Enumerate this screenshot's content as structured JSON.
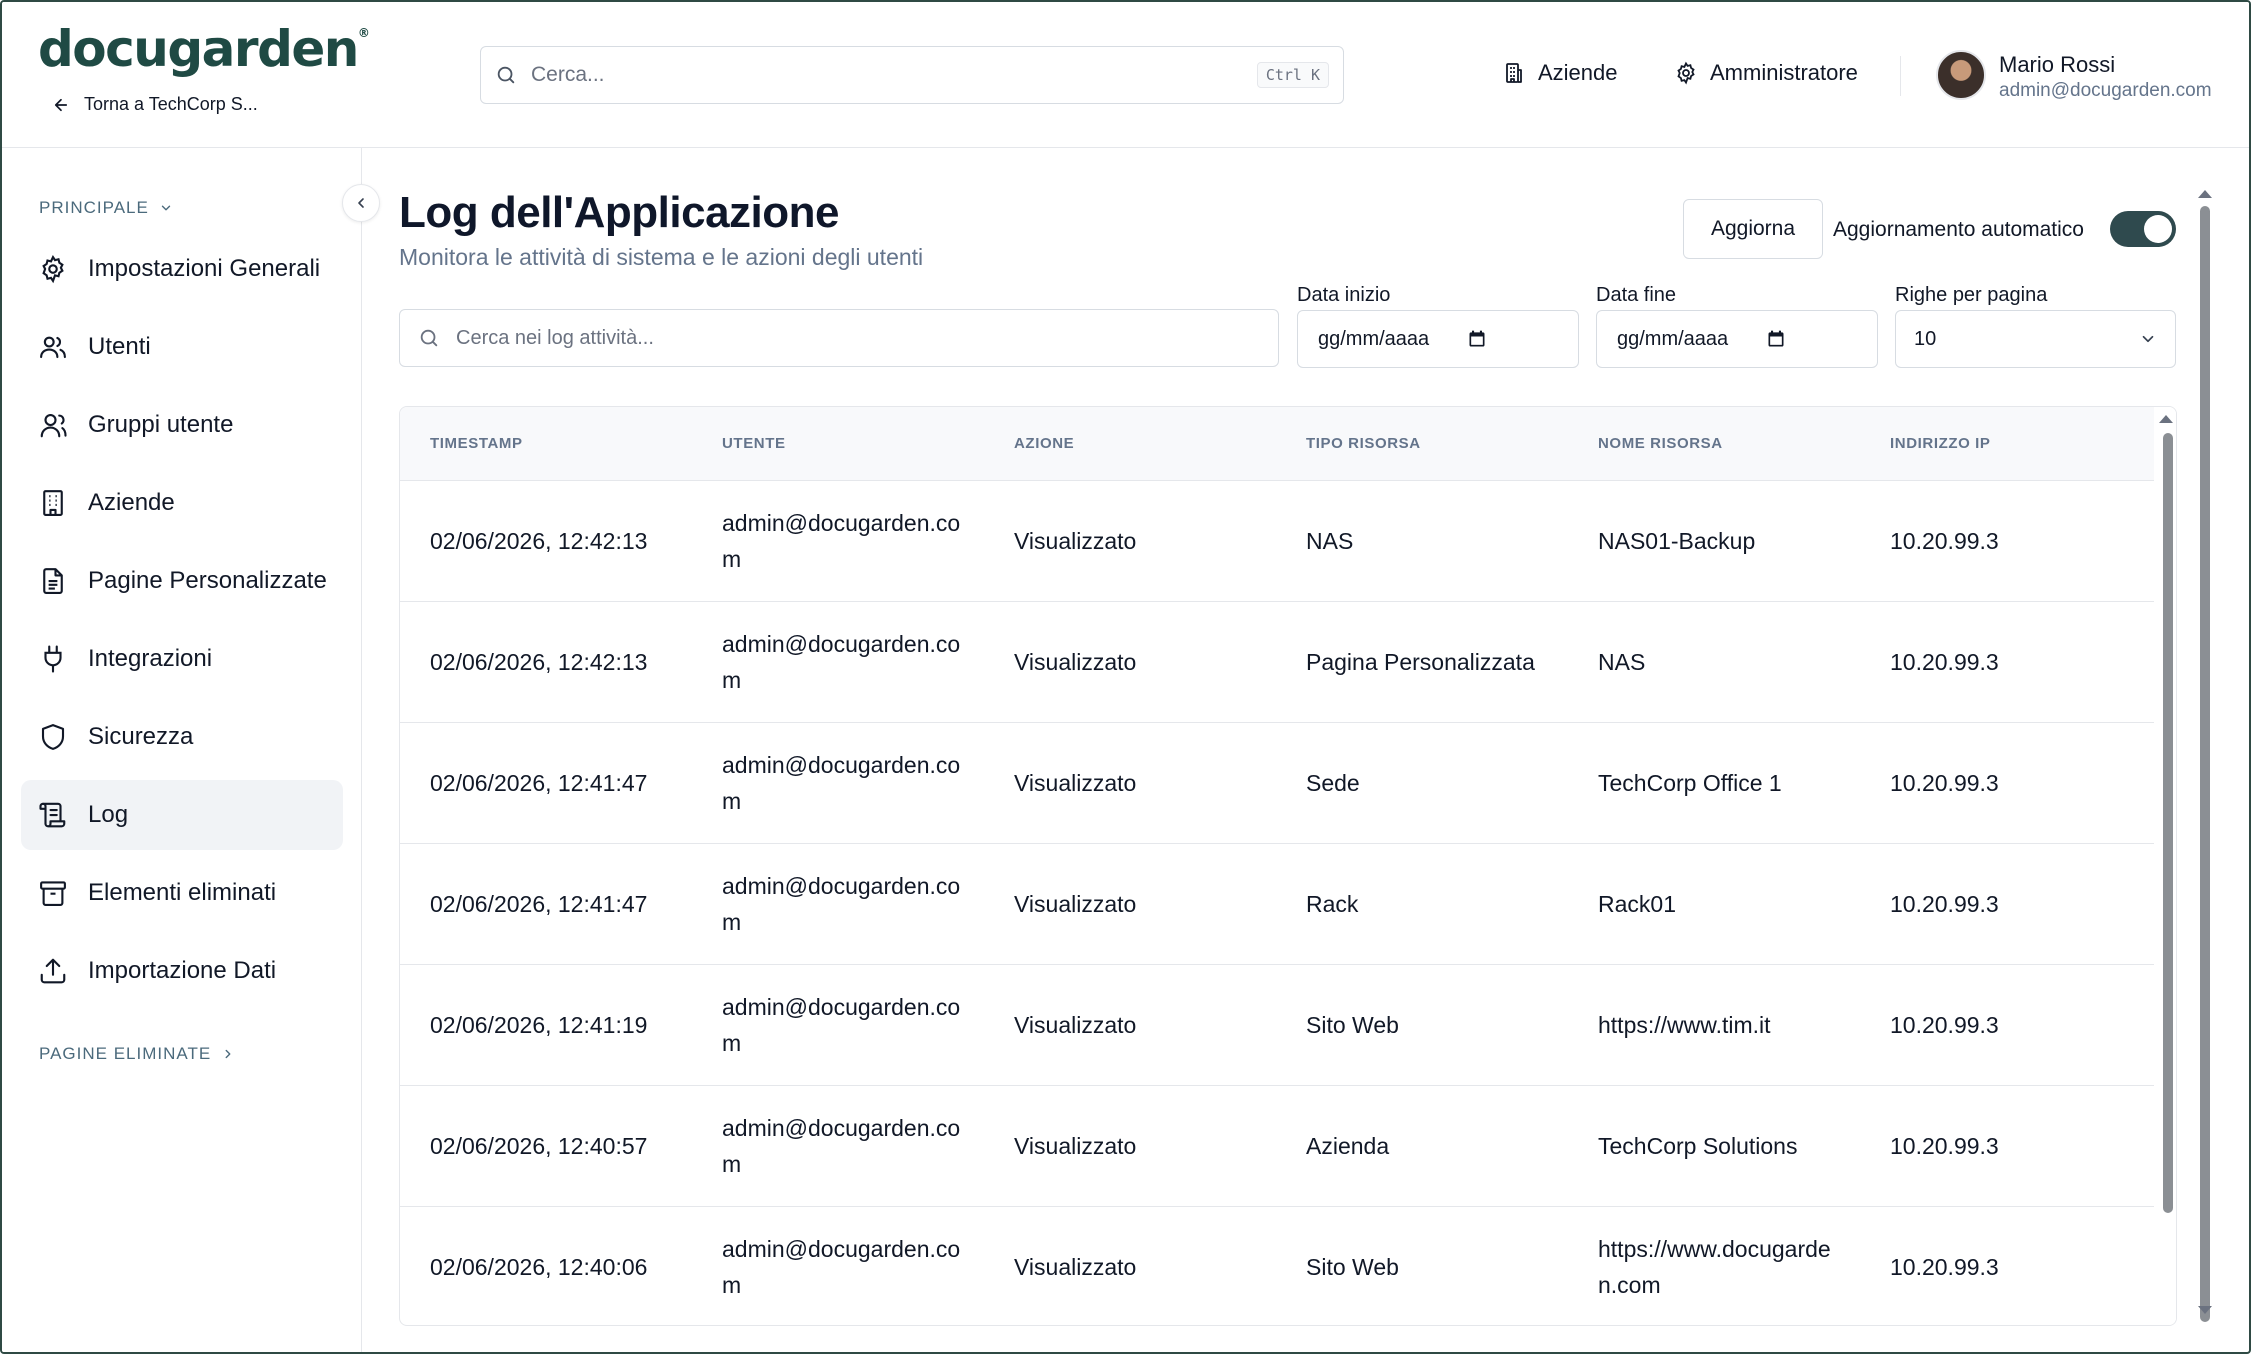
{
  "header": {
    "logo_text": "docugarden",
    "logo_mark": "®",
    "back_link": "Torna a TechCorp S...",
    "search_placeholder": "Cerca...",
    "search_shortcut": "Ctrl K",
    "nav": [
      {
        "label": "Aziende",
        "icon": "building-icon"
      },
      {
        "label": "Amministratore",
        "icon": "gear-icon"
      }
    ],
    "user": {
      "name": "Mario Rossi",
      "email": "admin@docugarden.com"
    }
  },
  "sidebar": {
    "section_main": "PRINCIPALE",
    "items": [
      {
        "label": "Impostazioni Generali",
        "icon": "gear-icon"
      },
      {
        "label": "Utenti",
        "icon": "users-icon"
      },
      {
        "label": "Gruppi utente",
        "icon": "user-group-icon"
      },
      {
        "label": "Aziende",
        "icon": "building-icon"
      },
      {
        "label": "Pagine Personalizzate",
        "icon": "document-icon"
      },
      {
        "label": "Integrazioni",
        "icon": "plug-icon"
      },
      {
        "label": "Sicurezza",
        "icon": "shield-icon"
      },
      {
        "label": "Log",
        "icon": "scroll-icon",
        "active": true
      },
      {
        "label": "Elementi eliminati",
        "icon": "archive-icon"
      },
      {
        "label": "Importazione Dati",
        "icon": "upload-icon"
      }
    ],
    "section_deleted": "PAGINE ELIMINATE"
  },
  "main": {
    "title": "Log dell'Applicazione",
    "subtitle": "Monitora le attività di sistema e le azioni degli utenti",
    "refresh_label": "Aggiorna",
    "auto_refresh_label": "Aggiornamento automatico",
    "auto_refresh_on": true,
    "search_placeholder": "Cerca nei log attività...",
    "filters": {
      "start_label": "Data inizio",
      "start_value": "gg/mm/aaaa",
      "end_label": "Data fine",
      "end_value": "gg/mm/aaaa",
      "rows_label": "Righe per pagina",
      "rows_value": "10"
    }
  },
  "table": {
    "columns": [
      "TIMESTAMP",
      "UTENTE",
      "AZIONE",
      "TIPO RISORSA",
      "NOME RISORSA",
      "INDIRIZZO IP"
    ],
    "rows": [
      {
        "timestamp": "02/06/2026, 12:42:13",
        "user": "admin@docugarden.com",
        "action": "Visualizzato",
        "type": "NAS",
        "name": "NAS01-Backup",
        "ip": "10.20.99.3"
      },
      {
        "timestamp": "02/06/2026, 12:42:13",
        "user": "admin@docugarden.com",
        "action": "Visualizzato",
        "type": "Pagina Personalizzata",
        "name": "NAS",
        "ip": "10.20.99.3"
      },
      {
        "timestamp": "02/06/2026, 12:41:47",
        "user": "admin@docugarden.com",
        "action": "Visualizzato",
        "type": "Sede",
        "name": "TechCorp Office 1",
        "ip": "10.20.99.3"
      },
      {
        "timestamp": "02/06/2026, 12:41:47",
        "user": "admin@docugarden.com",
        "action": "Visualizzato",
        "type": "Rack",
        "name": "Rack01",
        "ip": "10.20.99.3"
      },
      {
        "timestamp": "02/06/2026, 12:41:19",
        "user": "admin@docugarden.com",
        "action": "Visualizzato",
        "type": "Sito Web",
        "name": "https://www.tim.it",
        "ip": "10.20.99.3"
      },
      {
        "timestamp": "02/06/2026, 12:40:57",
        "user": "admin@docugarden.com",
        "action": "Visualizzato",
        "type": "Azienda",
        "name": "TechCorp Solutions",
        "ip": "10.20.99.3"
      },
      {
        "timestamp": "02/06/2026, 12:40:06",
        "user": "admin@docugarden.com",
        "action": "Visualizzato",
        "type": "Sito Web",
        "name": "https://www.docugarden.com",
        "ip": "10.20.99.3"
      }
    ]
  },
  "colors": {
    "brand": "#1f4a44",
    "toggle_on": "#2f4a4e",
    "active_item_bg": "#f1f3f6",
    "muted_text": "#64748b"
  }
}
